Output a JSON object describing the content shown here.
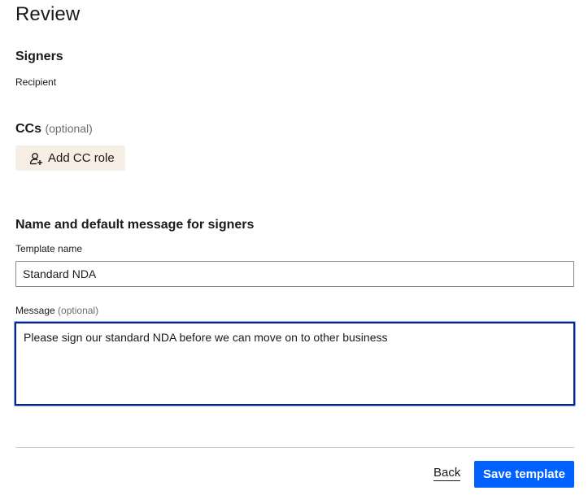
{
  "page": {
    "title": "Review"
  },
  "signers": {
    "title": "Signers",
    "recipient": "Recipient"
  },
  "ccs": {
    "title": "CCs",
    "optional": "(optional)",
    "add_button_label": "Add CC role",
    "add_button_icon": "user-add-icon"
  },
  "name_message": {
    "title": "Name and default message for signers",
    "template_label": "Template name",
    "template_value": "Standard NDA",
    "message_label": "Message",
    "message_optional": "(optional)",
    "message_value": "Please sign our standard NDA before we can move on to other business"
  },
  "footer": {
    "back_label": "Back",
    "save_label": "Save template"
  },
  "colors": {
    "primary": "#0061fe",
    "secondary_button_bg": "#f7efe6",
    "focus_border": "#0d2481"
  }
}
